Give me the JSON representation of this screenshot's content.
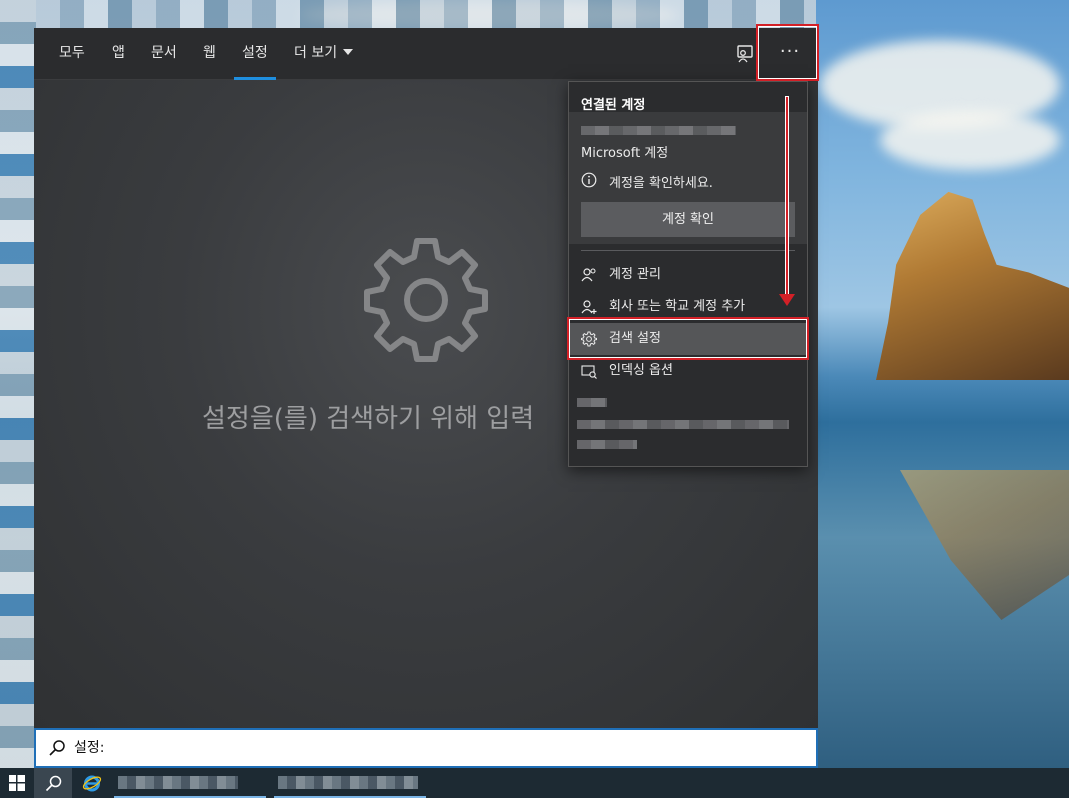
{
  "nav": {
    "tabs": [
      "모두",
      "앱",
      "문서",
      "웹",
      "설정",
      "더 보기"
    ],
    "active_tab": "설정",
    "more_menu_symbol": "···"
  },
  "main": {
    "prompt": "설정을(를) 검색하기 위해 입력"
  },
  "search": {
    "value": "설정:",
    "icon": "search-icon"
  },
  "menu": {
    "header": "연결된 계정",
    "account_type": "Microsoft 계정",
    "notice": "계정을 확인하세요.",
    "verify_button": "계정 확인",
    "items": [
      {
        "label": "계정 관리",
        "icon": "manage-account-icon"
      },
      {
        "label": "회사 또는 학교 계정 추가",
        "icon": "add-account-icon"
      },
      {
        "label": "검색 설정",
        "icon": "gear-icon"
      },
      {
        "label": "인덱싱 옵션",
        "icon": "indexing-icon"
      }
    ]
  },
  "colors": {
    "accent": "#1f8fe0",
    "annotation": "#d32027",
    "panel": "#2b2c2e"
  }
}
